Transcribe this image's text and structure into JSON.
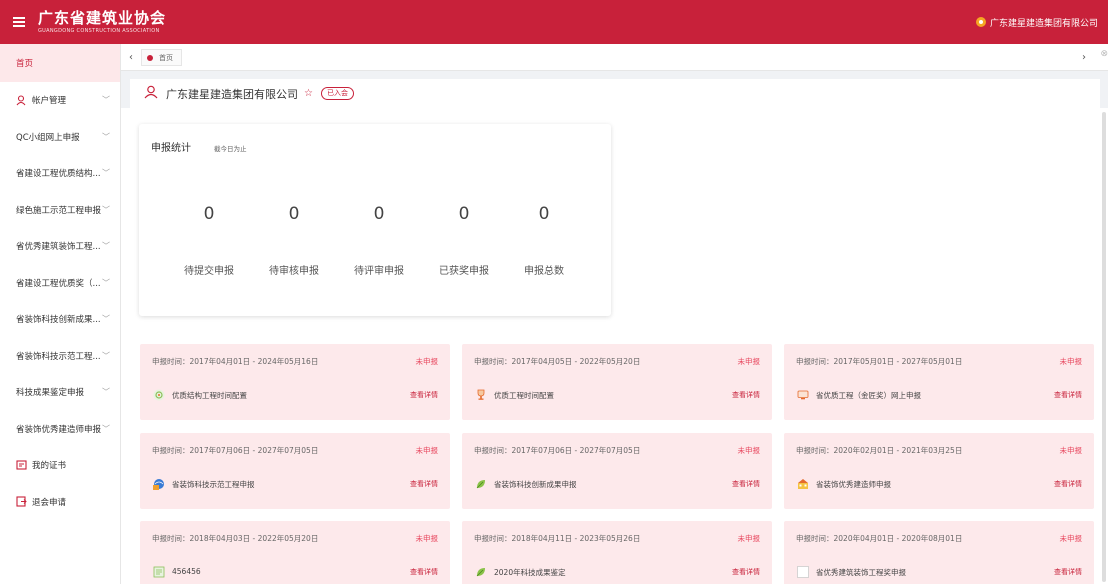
{
  "header": {
    "logo_title": "广东省建筑业协会",
    "logo_subtitle": "GUANGDONG CONSTRUCTION ASSOCIATION",
    "user_name": "广东建星建造集团有限公司",
    "brand_color": "#c8213a"
  },
  "sidebar": {
    "items": [
      {
        "label": "首页",
        "icon": "",
        "expandable": false
      },
      {
        "label": "帐户管理",
        "icon": "user-icon",
        "expandable": true
      },
      {
        "label": "QC小组网上申报",
        "icon": "",
        "expandable": true
      },
      {
        "label": "省建设工程优质结构...",
        "icon": "",
        "expandable": true
      },
      {
        "label": "绿色施工示范工程申报",
        "icon": "",
        "expandable": true
      },
      {
        "label": "省优秀建筑装饰工程...",
        "icon": "",
        "expandable": true
      },
      {
        "label": "省建设工程优质奖（...",
        "icon": "",
        "expandable": true
      },
      {
        "label": "省装饰科技创新成果...",
        "icon": "",
        "expandable": true
      },
      {
        "label": "省装饰科技示范工程...",
        "icon": "",
        "expandable": true
      },
      {
        "label": "科技成果鉴定申报",
        "icon": "",
        "expandable": true
      },
      {
        "label": "省装饰优秀建造师申报",
        "icon": "",
        "expandable": true
      },
      {
        "label": "我的证书",
        "icon": "certificate-icon",
        "expandable": false
      },
      {
        "label": "退会申请",
        "icon": "exit-icon",
        "expandable": false
      }
    ]
  },
  "tabs": {
    "home_label": "首页"
  },
  "company": {
    "name": "广东建星建造集团有限公司",
    "badge": "已入会"
  },
  "stats": {
    "title": "申报统计",
    "subtitle": "截今日为止",
    "items": [
      {
        "value": "0",
        "label": "待提交申报"
      },
      {
        "value": "0",
        "label": "待审核申报"
      },
      {
        "value": "0",
        "label": "待评审申报"
      },
      {
        "value": "0",
        "label": "已获奖申报"
      },
      {
        "value": "0",
        "label": "申报总数"
      }
    ]
  },
  "applications": [
    {
      "time": "申报时间：2017年04月01日 - 2024年05月16日",
      "status": "未申报",
      "name": "优质结构工程时间配置",
      "detail": "查看详情",
      "icon": "building-icon"
    },
    {
      "time": "申报时间：2017年04月05日 - 2022年05月20日",
      "status": "未申报",
      "name": "优质工程时间配置",
      "detail": "查看详情",
      "icon": "trophy-icon"
    },
    {
      "time": "申报时间：2017年05月01日 - 2027年05月01日",
      "status": "未申报",
      "name": "省优质工程（金匠奖）网上申报",
      "detail": "查看详情",
      "icon": "monitor-icon"
    },
    {
      "time": "申报时间：2017年07月06日 - 2027年07月05日",
      "status": "未申报",
      "name": "省装饰科技示范工程申报",
      "detail": "查看详情",
      "icon": "globe-icon"
    },
    {
      "time": "申报时间：2017年07月06日 - 2027年07月05日",
      "status": "未申报",
      "name": "省装饰科技创新成果申报",
      "detail": "查看详情",
      "icon": "leaf-icon"
    },
    {
      "time": "申报时间：2020年02月01日 - 2021年03月25日",
      "status": "未申报",
      "name": "省装饰优秀建造师申报",
      "detail": "查看详情",
      "icon": "crane-icon"
    },
    {
      "time": "申报时间：2018年04月03日 - 2022年05月20日",
      "status": "未申报",
      "name": "456456",
      "detail": "查看详情",
      "icon": "document-icon"
    },
    {
      "time": "申报时间：2018年04月11日 - 2023年05月26日",
      "status": "未申报",
      "name": "2020年科技成果鉴定",
      "detail": "查看详情",
      "icon": "leaf-icon"
    },
    {
      "time": "申报时间：2020年04月01日 - 2020年08月01日",
      "status": "未申报",
      "name": "省优秀建筑装饰工程奖申报",
      "detail": "查看详情",
      "icon": "blank-icon"
    }
  ]
}
